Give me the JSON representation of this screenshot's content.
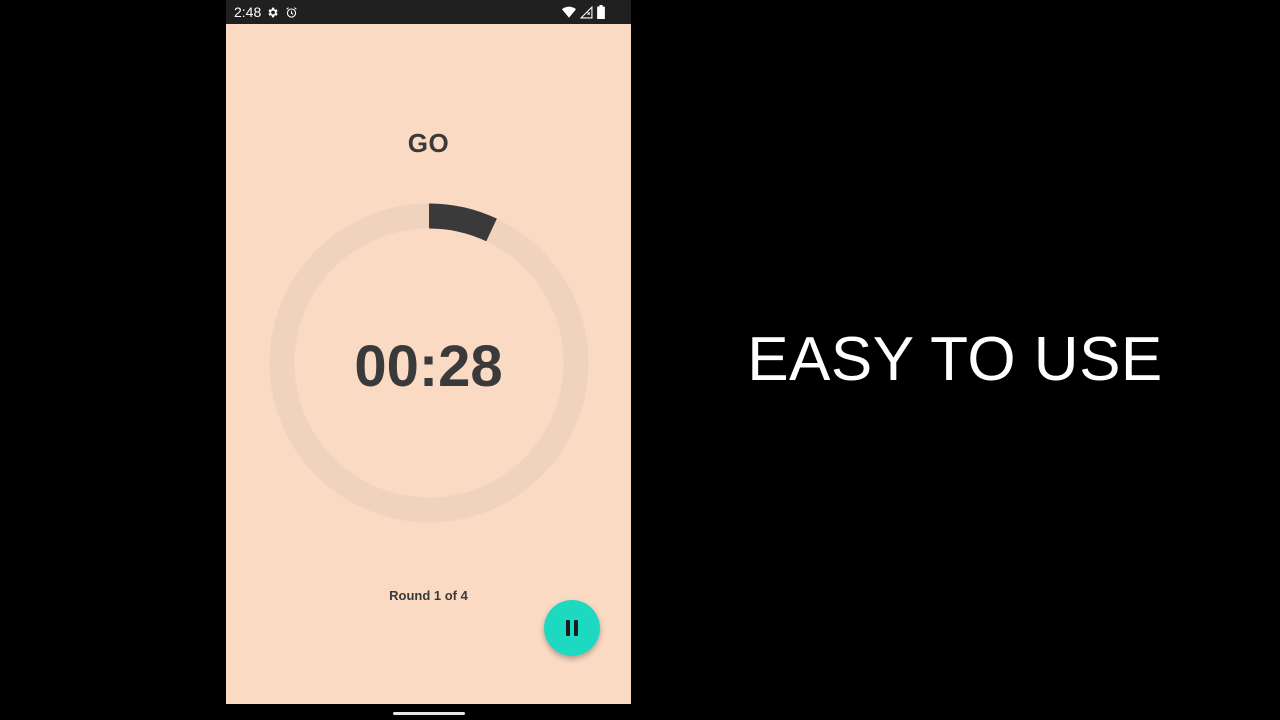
{
  "status_bar": {
    "time": "2:48",
    "left_icons": [
      "gear-icon",
      "alarm-icon"
    ],
    "right_icons": [
      "wifi-icon",
      "cell-signal-icon",
      "battery-icon"
    ]
  },
  "timer": {
    "phase_label": "GO",
    "time_remaining": "00:28",
    "round_text": "Round 1 of 4",
    "progress_fraction": 0.07
  },
  "controls": {
    "pause_icon": "pause-icon"
  },
  "caption": {
    "text": "EASY TO USE"
  },
  "colors": {
    "screen_bg": "#fbdac4",
    "ring_track": "#f0d3bf",
    "ring_progress": "#3a3a3a",
    "fab": "#1ed9c1",
    "text_dark": "#3a3a3a",
    "page_bg": "#000000"
  }
}
